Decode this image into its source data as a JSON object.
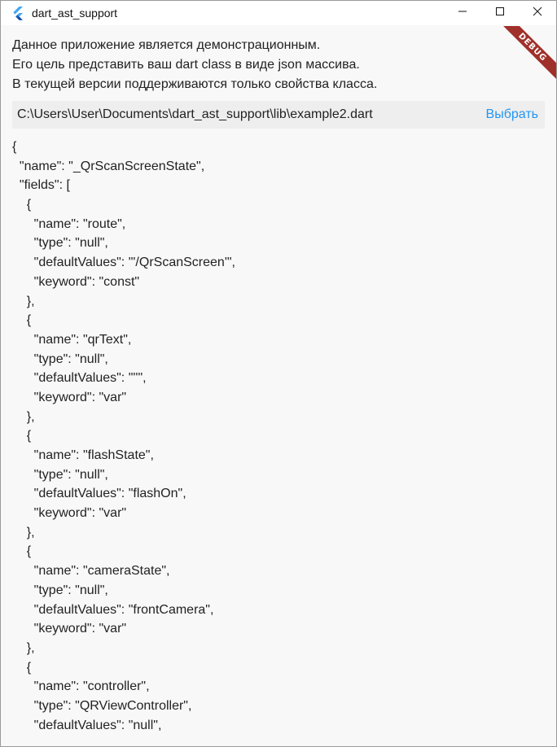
{
  "window": {
    "title": "dart_ast_support",
    "icon": "flutter-logo-icon",
    "controls": [
      "minimize-icon",
      "maximize-icon",
      "close-icon"
    ]
  },
  "debug_banner": "DEBUG",
  "description": {
    "line1": "Данное приложение является демонстрационным.",
    "line2": "Его цель представить ваш dart class в виде json массива.",
    "line3": "В текущей версии поддерживаются только свойства класса."
  },
  "file": {
    "path": "C:\\Users\\User\\Documents\\dart_ast_support\\lib\\example2.dart",
    "choose_label": "Выбрать"
  },
  "json_lines": [
    "{",
    "  \"name\": \"_QrScanScreenState\",",
    "  \"fields\": [",
    "    {",
    "      \"name\": \"route\",",
    "      \"type\": \"null\",",
    "      \"defaultValues\": \"'/QrScanScreen'\",",
    "      \"keyword\": \"const\"",
    "    },",
    "    {",
    "      \"name\": \"qrText\",",
    "      \"type\": \"null\",",
    "      \"defaultValues\": \"''\",",
    "      \"keyword\": \"var\"",
    "    },",
    "    {",
    "      \"name\": \"flashState\",",
    "      \"type\": \"null\",",
    "      \"defaultValues\": \"flashOn\",",
    "      \"keyword\": \"var\"",
    "    },",
    "    {",
    "      \"name\": \"cameraState\",",
    "      \"type\": \"null\",",
    "      \"defaultValues\": \"frontCamera\",",
    "      \"keyword\": \"var\"",
    "    },",
    "    {",
    "      \"name\": \"controller\",",
    "      \"type\": \"QRViewController\",",
    "      \"defaultValues\": \"null\","
  ],
  "colors": {
    "accent": "#2196f3",
    "debug_ribbon": "#a0302a",
    "background": "#f8f8f8",
    "path_bar": "#eeeeee"
  }
}
